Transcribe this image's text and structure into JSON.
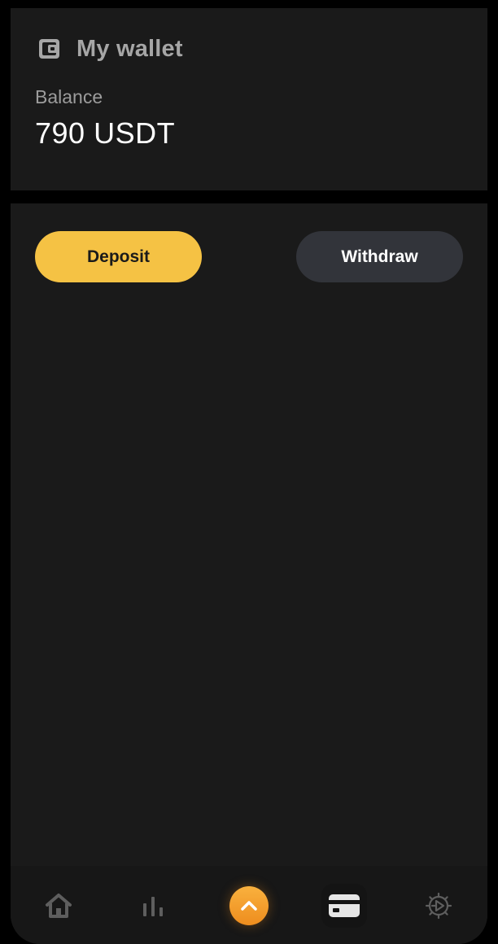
{
  "wallet": {
    "title": "My wallet",
    "icon": "wallet-icon",
    "balance_label": "Balance",
    "balance_value": "790 USDT"
  },
  "actions": {
    "deposit_label": "Deposit",
    "withdraw_label": "Withdraw"
  },
  "nav": {
    "items": [
      {
        "icon": "home-icon",
        "active": false
      },
      {
        "icon": "bar-chart-icon",
        "active": false
      },
      {
        "icon": "chevron-up-icon",
        "active": false
      },
      {
        "icon": "card-icon",
        "active": true
      },
      {
        "icon": "settings-icon",
        "active": false
      }
    ]
  },
  "colors": {
    "background": "#000000",
    "card": "#1a1a1a",
    "accent_yellow": "#f5c244",
    "accent_orange": "#f29a2b",
    "secondary_button": "#32343a",
    "muted_text": "#9c9c9c",
    "icon_inactive": "#5e5e5e"
  }
}
